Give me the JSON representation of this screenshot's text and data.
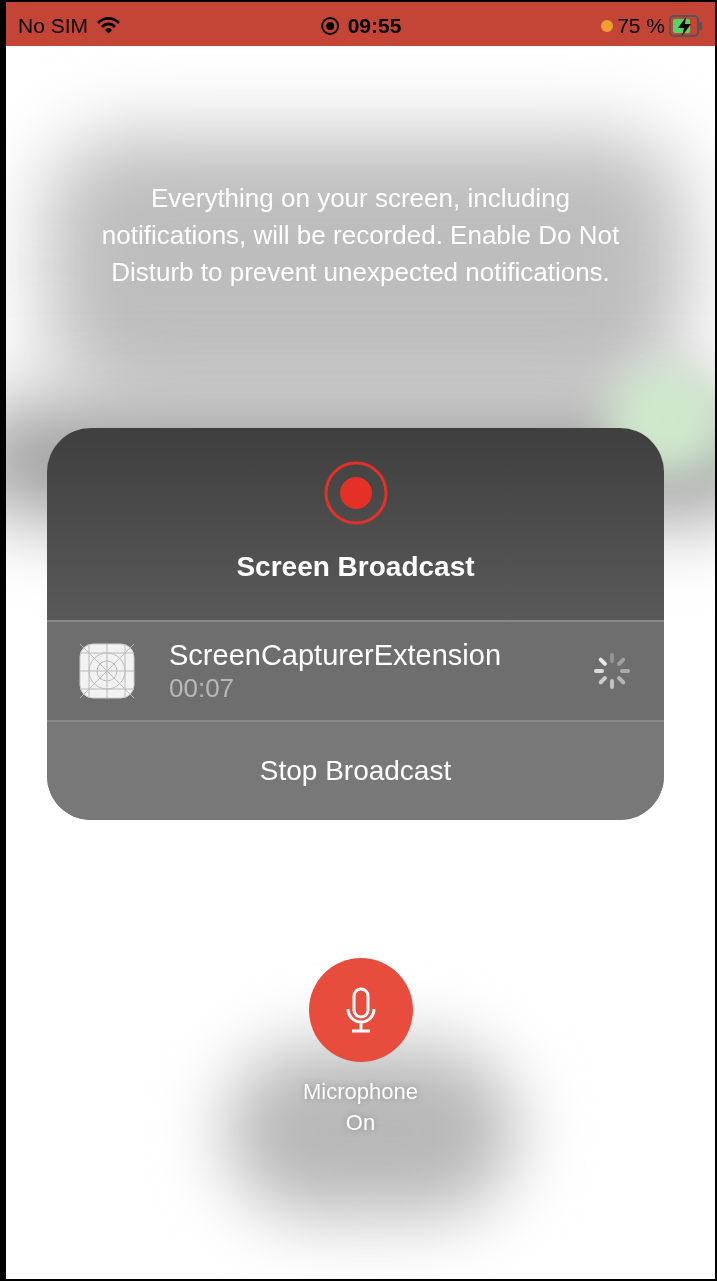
{
  "status_bar": {
    "carrier": "No SIM",
    "time": "09:55",
    "recording": true,
    "battery": "75 %",
    "charging": true
  },
  "notice": "Everything on your screen, including notifications, will be recorded. Enable Do Not Disturb to prevent unexpected notifications.",
  "panel": {
    "title": "Screen Broadcast",
    "recording": true,
    "extension": {
      "name": "ScreenCapturerExtension",
      "elapsed": "00:07",
      "busy": true
    },
    "stop_button": "Stop Broadcast"
  },
  "microphone": {
    "label": "Microphone On",
    "on": true
  }
}
